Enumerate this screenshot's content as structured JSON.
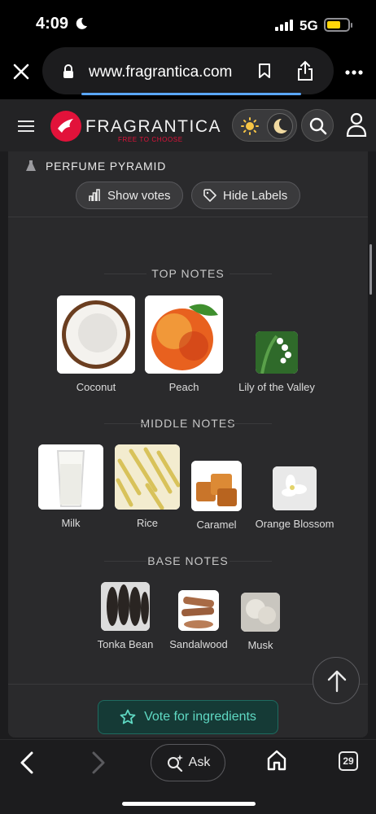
{
  "status_bar": {
    "time": "4:09",
    "network": "5G"
  },
  "browser": {
    "url": "www.fragrantica.com"
  },
  "site": {
    "brand": "FRAGRANTICA",
    "tagline": "FREE TO CHOOSE"
  },
  "pyramid": {
    "title": "PERFUME PYRAMID",
    "show_votes_label": "Show votes",
    "hide_labels_label": "Hide Labels",
    "top_heading": "TOP NOTES",
    "top_notes": [
      "Coconut",
      "Peach",
      "Lily of the Valley"
    ],
    "middle_heading": "MIDDLE NOTES",
    "middle_notes": [
      "Milk",
      "Rice",
      "Caramel",
      "Orange Blossom"
    ],
    "base_heading": "BASE NOTES",
    "base_notes": [
      "Tonka Bean",
      "Sandalwood",
      "Musk"
    ],
    "vote_ingredients_label": "Vote for ingredients"
  },
  "toolbar": {
    "ask_label": "Ask",
    "tab_count": "29"
  },
  "colors": {
    "accent_red": "#e2123a",
    "teal": "#5fd9c3",
    "progress_blue": "#5aa7ff"
  }
}
